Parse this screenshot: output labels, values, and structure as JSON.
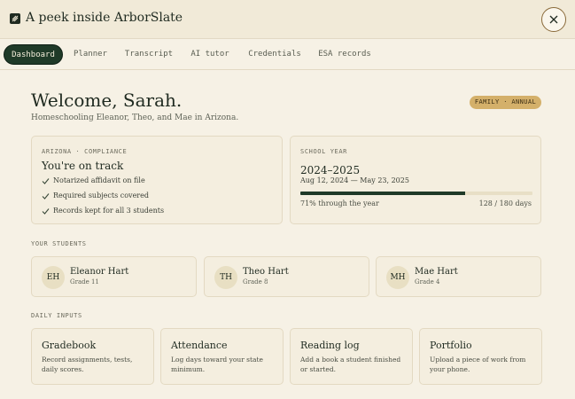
{
  "app": {
    "title": "A peek inside ArborSlate"
  },
  "tabs": [
    {
      "label": "Dashboard",
      "active": true
    },
    {
      "label": "Planner"
    },
    {
      "label": "Transcript"
    },
    {
      "label": "AI tutor"
    },
    {
      "label": "Credentials"
    },
    {
      "label": "ESA records"
    }
  ],
  "welcome": {
    "heading": "Welcome, Sarah.",
    "subtitle": "Homeschooling Eleanor, Theo, and Mae in Arizona.",
    "plan_badge": "FAMILY · ANNUAL"
  },
  "compliance": {
    "eyebrow": "ARIZONA · COMPLIANCE",
    "title": "You're on track",
    "items": [
      "Notarized affidavit on file",
      "Required subjects covered",
      "Records kept for all 3 students"
    ]
  },
  "school_year": {
    "eyebrow": "SCHOOL YEAR",
    "range": "2024–2025",
    "dates": "Aug 12, 2024 — May 23, 2025",
    "progress_fraction": 0.71,
    "progress_text": "71% through the year",
    "days_text": "128 / 180 days"
  },
  "students_section": {
    "label": "YOUR STUDENTS",
    "students": [
      {
        "initials": "EH",
        "name": "Eleanor Hart",
        "grade": "Grade 11"
      },
      {
        "initials": "TH",
        "name": "Theo Hart",
        "grade": "Grade 8"
      },
      {
        "initials": "MH",
        "name": "Mae Hart",
        "grade": "Grade 4"
      }
    ]
  },
  "daily_inputs": {
    "label": "DAILY INPUTS",
    "items": [
      {
        "title": "Gradebook",
        "desc": "Record assignments, tests, daily scores."
      },
      {
        "title": "Attendance",
        "desc": "Log days toward your state minimum."
      },
      {
        "title": "Reading log",
        "desc": "Add a book a student finished or started."
      },
      {
        "title": "Portfolio",
        "desc": "Upload a piece of work from your phone."
      }
    ]
  },
  "colors": {
    "accent": "#1f3a28",
    "badge": "#d4b06a",
    "background": "#f6f1e5"
  },
  "icons": {
    "close": "close-icon",
    "check": "check-icon",
    "logo": "logo-icon"
  }
}
